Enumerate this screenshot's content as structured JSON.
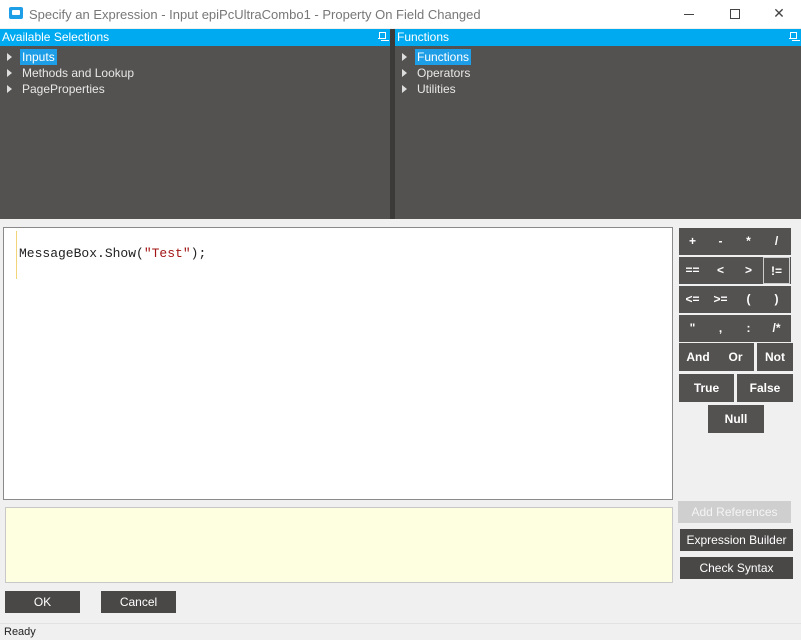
{
  "window": {
    "title": "Specify an Expression - Input epiPcUltraCombo1 - Property On Field Changed",
    "controls": {
      "minimize_icon": "minimize-icon",
      "maximize_icon": "maximize-icon",
      "close_glyph": "✕"
    }
  },
  "available_selections": {
    "header": "Available Selections",
    "items": [
      {
        "label": "Inputs",
        "selected": true
      },
      {
        "label": "Methods and Lookup",
        "selected": false
      },
      {
        "label": "PageProperties",
        "selected": false
      }
    ]
  },
  "functions": {
    "header": "Functions",
    "items": [
      {
        "label": "Functions",
        "selected": true
      },
      {
        "label": "Operators",
        "selected": false
      },
      {
        "label": "Utilities",
        "selected": false
      }
    ]
  },
  "editor": {
    "code_prefix": "MessageBox.Show(",
    "code_string": "\"Test\"",
    "code_suffix": ");"
  },
  "operators": {
    "row1": [
      "+",
      "-",
      "*",
      "/"
    ],
    "row2": [
      "==",
      "<",
      ">",
      "!="
    ],
    "row3": [
      "<=",
      ">=",
      "(",
      ")"
    ],
    "row4": [
      "\"",
      ",",
      ":",
      "/*"
    ],
    "logic": [
      "And",
      "Or",
      "Not"
    ],
    "bool": [
      "True",
      "False"
    ],
    "null": "Null"
  },
  "actions": {
    "add_references": "Add References",
    "expression_builder": "Expression Builder",
    "check_syntax": "Check Syntax"
  },
  "footer": {
    "ok": "OK",
    "cancel": "Cancel",
    "status": "Ready"
  },
  "colors": {
    "accent": "#00aaf0",
    "panel_bg": "#545250",
    "notes_bg": "#fefee0",
    "string_color": "#a31515"
  }
}
